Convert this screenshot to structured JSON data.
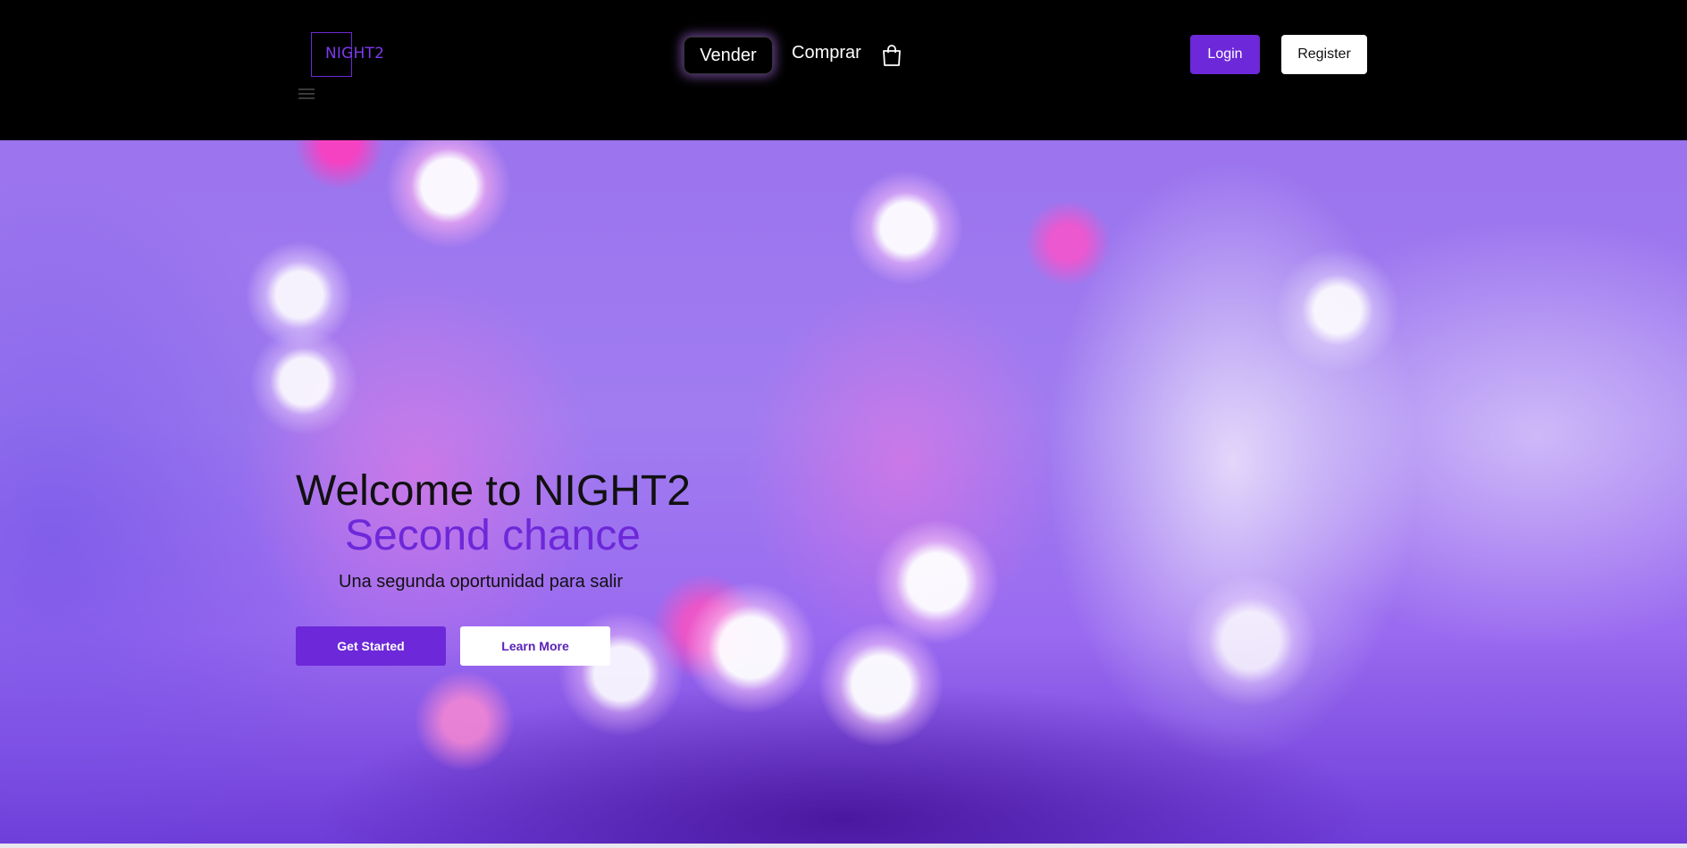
{
  "header": {
    "logo_text": "NIGHT2",
    "nav": {
      "vender": "Vender",
      "comprar": "Comprar"
    },
    "login_label": "Login",
    "register_label": "Register"
  },
  "hero": {
    "title": "Welcome to NIGHT2",
    "subtitle": "Second chance",
    "tagline": "Una segunda oportunidad para salir",
    "get_started_label": "Get Started",
    "learn_more_label": "Learn More"
  },
  "icons": [
    "menu-icon",
    "shopping-bag-icon"
  ],
  "colors": {
    "accent": "#6d28d9",
    "header_bg": "#000000"
  }
}
